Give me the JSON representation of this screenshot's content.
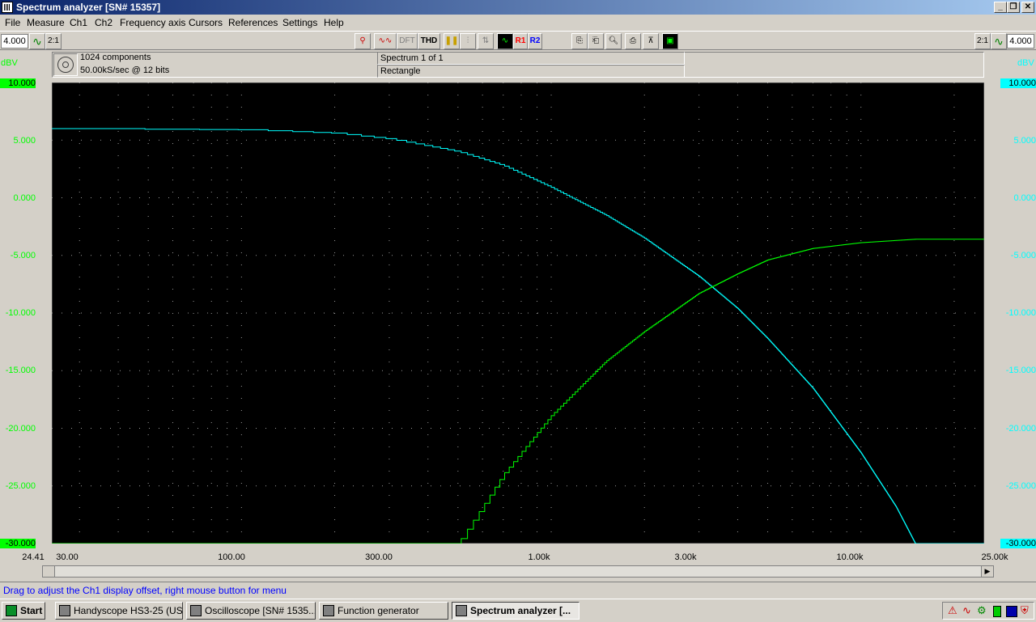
{
  "window": {
    "title": "Spectrum analyzer  [SN# 15357]"
  },
  "menu": [
    "File",
    "Measure",
    "Ch1",
    "Ch2",
    "Frequency axis",
    "Cursors",
    "References",
    "Settings",
    "Help"
  ],
  "toolbar": {
    "ch1_scale": "4.000",
    "ch2_scale": "4.000",
    "dft_label": "DFT",
    "thd_label": "THD",
    "r1_label": "R1",
    "r2_label": "R2",
    "scale_ratio_label": "2:1"
  },
  "info": {
    "components": "1024 components",
    "sample_rate": "50.00kS/sec @ 12 bits",
    "spectrum": "Spectrum 1 of 1",
    "window": "Rectangle"
  },
  "axis": {
    "unit_left": "dBV",
    "unit_right": "dBV",
    "y_ticks": [
      "10.000",
      "5.000",
      "0.000",
      "-5.000",
      "-10.000",
      "-15.000",
      "-20.000",
      "-25.000",
      "-30.000"
    ],
    "x_ticks": [
      "24.41",
      "30.00",
      "100.00",
      "300.00",
      "1.00k",
      "3.00k",
      "10.00k",
      "25.00k"
    ]
  },
  "colors": {
    "ch1": "#00ffff",
    "ch2": "#00ff00",
    "plot_bg": "#000000"
  },
  "chart_data": {
    "type": "line",
    "x_scale": "log",
    "xlim": [
      24.41,
      25000
    ],
    "ylim": [
      -30,
      10
    ],
    "ylabel": "dBV",
    "series": [
      {
        "color": "#00ffff",
        "axis": "right",
        "x": [
          24.41,
          100,
          200,
          300,
          500,
          700,
          1000,
          1500,
          2000,
          3000,
          4000,
          5000,
          7000,
          10000,
          13000,
          15000,
          25000
        ],
        "y": [
          6.0,
          5.9,
          5.6,
          5.1,
          4.0,
          2.8,
          0.9,
          -1.5,
          -3.5,
          -6.8,
          -9.6,
          -12.2,
          -16.5,
          -22.1,
          -26.8,
          -30,
          -30
        ]
      },
      {
        "color": "#00ff00",
        "axis": "left",
        "x": [
          24.41,
          500,
          520,
          600,
          700,
          1000,
          1500,
          2000,
          3000,
          4000,
          5000,
          7000,
          10000,
          15000,
          25000
        ],
        "y": [
          -30,
          -30,
          -29.3,
          -26.8,
          -24.0,
          -18.9,
          -14.2,
          -11.6,
          -8.3,
          -6.6,
          -5.4,
          -4.4,
          -3.9,
          -3.6,
          -3.6
        ]
      }
    ]
  },
  "status": {
    "message": "Drag to adjust the Ch1 display offset, right mouse button for menu"
  },
  "taskbar": {
    "start": "Start",
    "tasks": [
      "Handyscope HS3-25 (US...",
      "Oscilloscope  [SN# 1535...",
      "Function generator",
      "Spectrum analyzer  [..."
    ]
  }
}
